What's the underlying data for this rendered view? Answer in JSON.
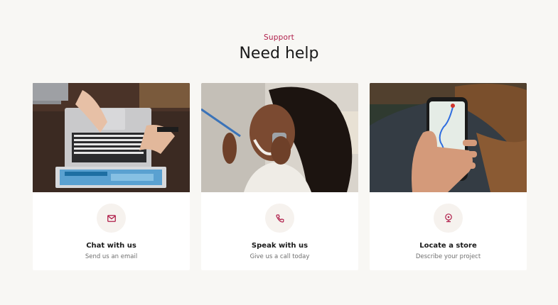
{
  "header": {
    "eyebrow": "Support",
    "title": "Need help"
  },
  "colors": {
    "accent": "#b01e4a",
    "background": "#f8f7f4",
    "card": "#ffffff",
    "icon_bg": "#f6f2ee"
  },
  "cards": [
    {
      "title": "Chat with us",
      "subtitle": "Send us an email",
      "icon": "mail-icon"
    },
    {
      "title": "Speak with us",
      "subtitle": "Give us a call today",
      "icon": "phone-icon"
    },
    {
      "title": "Locate a store",
      "subtitle": "Describe your project",
      "icon": "location-pin-icon"
    }
  ]
}
